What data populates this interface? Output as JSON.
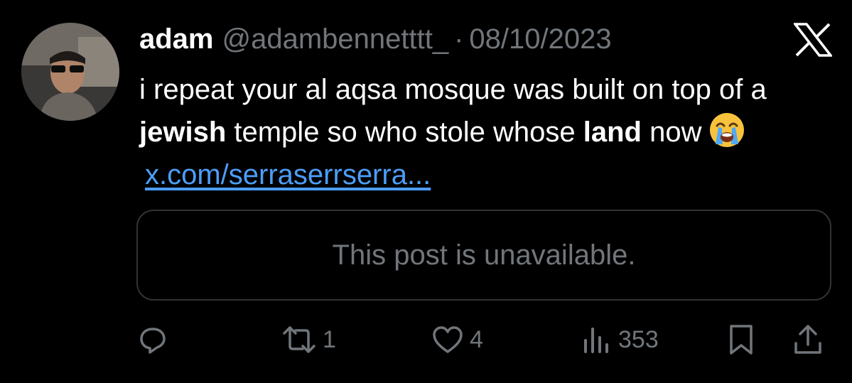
{
  "author": {
    "name": "adam",
    "handle": "@adambennetttt_",
    "separator": "·",
    "date": "08/10/2023"
  },
  "post": {
    "text_1": "i repeat your al aqsa mosque was built on top of a ",
    "bold_1": "jewish",
    "text_2": " temple so who stole whose ",
    "bold_2": "land",
    "text_3": " now",
    "emoji": "loudly-crying-face",
    "link": "x.com/serraserrserra..."
  },
  "quote": {
    "unavailable_text": "This post is unavailable."
  },
  "actions": {
    "reposts": "1",
    "likes": "4",
    "views": "353"
  },
  "icons": {
    "reply": "reply-icon",
    "repost": "repost-icon",
    "like": "heart-icon",
    "views": "views-icon",
    "bookmark": "bookmark-icon",
    "share": "share-icon",
    "brand": "x-logo-icon"
  },
  "colors": {
    "background": "#000000",
    "text": "#ffffff",
    "secondary": "#71767b",
    "link": "#4c9ef8",
    "border": "#2f3336"
  }
}
